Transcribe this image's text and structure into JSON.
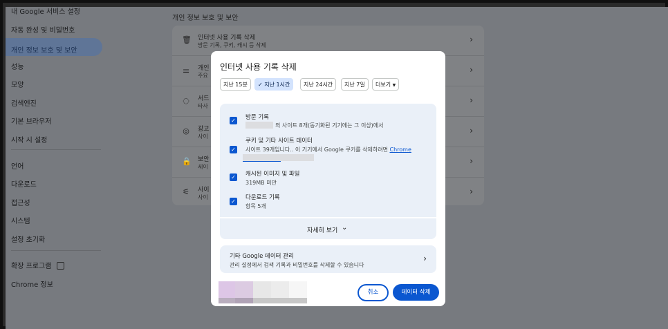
{
  "sidebar": {
    "items": [
      {
        "label": "내 Google 서비스 설정"
      },
      {
        "label": "자동 완성 및 비밀번호"
      },
      {
        "label": "개인 정보 보호 및 보안"
      },
      {
        "label": "성능"
      },
      {
        "label": "모양"
      },
      {
        "label": "검색엔진"
      },
      {
        "label": "기본 브라우저"
      },
      {
        "label": "시작 시 설정"
      },
      {
        "label": "언어"
      },
      {
        "label": "다운로드"
      },
      {
        "label": "접근성"
      },
      {
        "label": "시스템"
      },
      {
        "label": "설정 초기화"
      },
      {
        "label": "확장 프로그램"
      },
      {
        "label": "Chrome 정보"
      }
    ],
    "selected": "개인 정보 보호 및 보안"
  },
  "main": {
    "title": "개인 정보 보호 및 보안",
    "rows": [
      {
        "title": "인터넷 사용 기록 삭제",
        "subtitle": "방문 기록, 쿠키, 캐시 등 삭제",
        "icon": "trash-icon"
      },
      {
        "title": "개인",
        "subtitle": "주요",
        "icon": "tune-icon"
      },
      {
        "title": "서드",
        "subtitle": "타사",
        "icon": "cookie-icon"
      },
      {
        "title": "광고",
        "subtitle": "사이",
        "icon": "ads-icon"
      },
      {
        "title": "보안",
        "subtitle": "세이",
        "icon": "lock-icon"
      },
      {
        "title": "사이",
        "subtitle": "사이",
        "icon": "site-settings-icon"
      }
    ]
  },
  "dialog": {
    "title": "인터넷 사용 기록 삭제",
    "time_ranges": [
      "지난 15분",
      "지난 1시간",
      "지난 24시간",
      "지난 7일",
      "더보기"
    ],
    "selected_time_range": "지난 1시간",
    "items": [
      {
        "title": "방문 기록",
        "detail": "외 사이트 8개(동기화된 기기에는 그 이상)에서",
        "checked": true
      },
      {
        "title": "쿠키 및 기타 사이트 데이터",
        "detail": "사이트 39개입니다.. 이 기기에서 Google 쿠키를 삭제하려면",
        "link": "Chrome",
        "checked": true
      },
      {
        "title": "캐시된 이미지 및 파일",
        "detail": "319MB 미만",
        "checked": true
      },
      {
        "title": "다운로드 기록",
        "detail": "항목 5개",
        "checked": true
      }
    ],
    "more_label": "자세히 보기",
    "other": {
      "title": "기타 Google 데이터 관리",
      "subtitle": "관리 설정에서 검색 기록과 비밀번호를 삭제할 수 있습니다"
    },
    "cancel_label": "취소",
    "delete_label": "데이터 삭제"
  },
  "colors": {
    "accent": "#0b57d0",
    "chip_selected": "#d3e3fd",
    "panel": "#eaf0f8",
    "dim_overlay": "#777a7f"
  }
}
